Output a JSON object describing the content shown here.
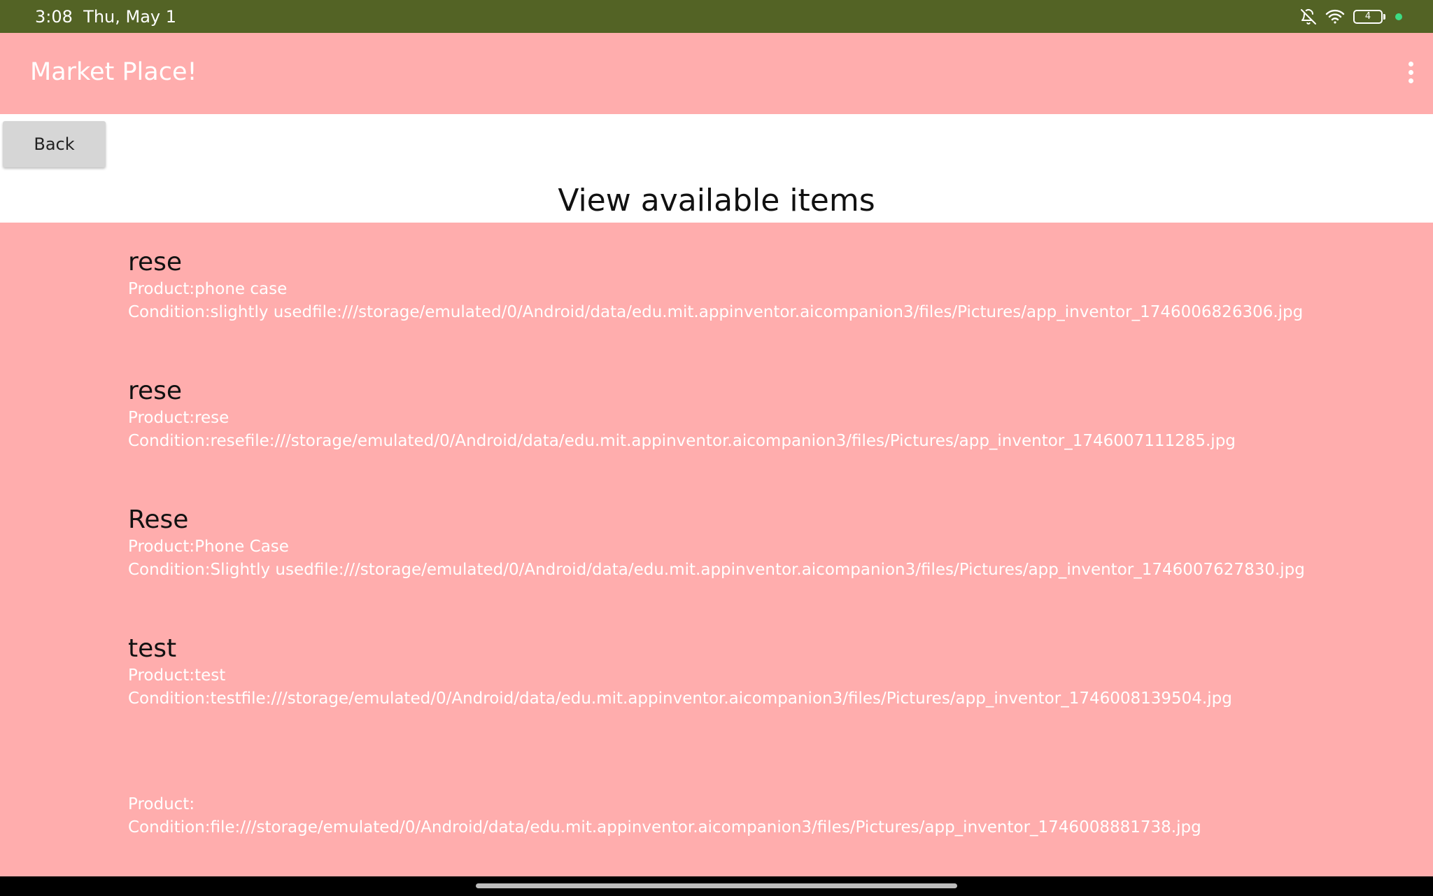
{
  "status_bar": {
    "time": "3:08",
    "date": "Thu, May 1",
    "battery_level": "4",
    "color": "#536325"
  },
  "app_bar": {
    "title": "Market Place!",
    "color": "#ffadad"
  },
  "toolbar": {
    "back_label": "Back"
  },
  "page": {
    "title": "View available items"
  },
  "items": [
    {
      "name": "rese",
      "product": "Product:phone case",
      "condition": "Condition:slightly usedfile:///storage/emulated/0/Android/data/edu.mit.appinventor.aicompanion3/files/Pictures/app_inventor_1746006826306.jpg"
    },
    {
      "name": "rese",
      "product": "Product:rese",
      "condition": "Condition:resefile:///storage/emulated/0/Android/data/edu.mit.appinventor.aicompanion3/files/Pictures/app_inventor_1746007111285.jpg"
    },
    {
      "name": "Rese",
      "product": "Product:Phone Case",
      "condition": "Condition:Slightly usedfile:///storage/emulated/0/Android/data/edu.mit.appinventor.aicompanion3/files/Pictures/app_inventor_1746007627830.jpg"
    },
    {
      "name": "test",
      "product": "Product:test",
      "condition": "Condition:testfile:///storage/emulated/0/Android/data/edu.mit.appinventor.aicompanion3/files/Pictures/app_inventor_1746008139504.jpg"
    },
    {
      "name": "",
      "product": "Product:",
      "condition": "Condition:file:///storage/emulated/0/Android/data/edu.mit.appinventor.aicompanion3/files/Pictures/app_inventor_1746008881738.jpg"
    }
  ],
  "icons": {
    "notifications_muted": "bell-off-icon",
    "wifi": "wifi-icon",
    "battery": "battery-icon",
    "privacy_indicator": "green-dot-icon",
    "overflow_menu": "more-vert-icon"
  }
}
